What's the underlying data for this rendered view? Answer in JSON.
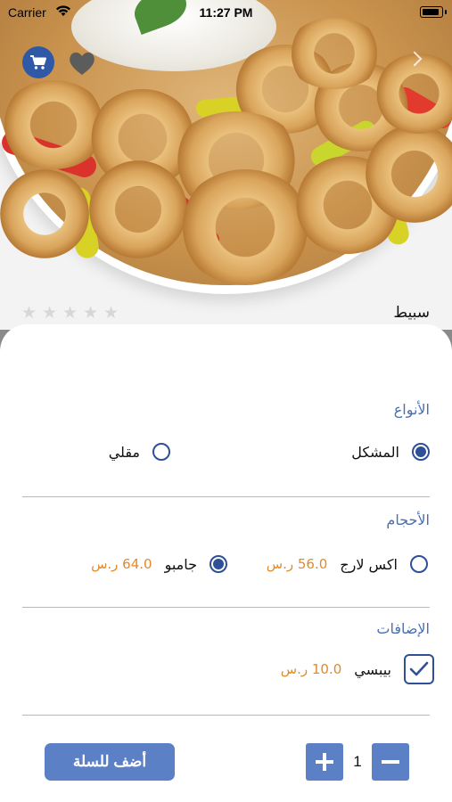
{
  "status_bar": {
    "carrier": "Carrier",
    "time": "11:27 PM"
  },
  "product": {
    "name": "سبيط",
    "rating": 0,
    "max_rating": 5
  },
  "sections": {
    "types": {
      "title": "الأنواع",
      "options": [
        {
          "label": "المشكل",
          "selected": true
        },
        {
          "label": "مقلي",
          "selected": false
        }
      ]
    },
    "sizes": {
      "title": "الأحجام",
      "options": [
        {
          "label": "اكس لارج",
          "price": "56.0 ر.س",
          "selected": false
        },
        {
          "label": "جامبو",
          "price": "64.0 ر.س",
          "selected": true
        }
      ]
    },
    "extras": {
      "title": "الإضافات",
      "items": [
        {
          "label": "بيبسي",
          "price": "10.0 ر.س",
          "checked": true
        }
      ]
    }
  },
  "actions": {
    "add_to_cart_label": "أضف للسلة",
    "quantity": "1"
  },
  "colors": {
    "primary": "#2f4f96",
    "button": "#5b80c6",
    "section_title": "#4a6fb3",
    "price": "#e08a2b"
  },
  "icons": [
    "cart-icon",
    "heart-icon",
    "chevron-right-icon",
    "star-icon",
    "plus-icon",
    "minus-icon",
    "check-icon",
    "wifi-icon",
    "battery-icon"
  ]
}
